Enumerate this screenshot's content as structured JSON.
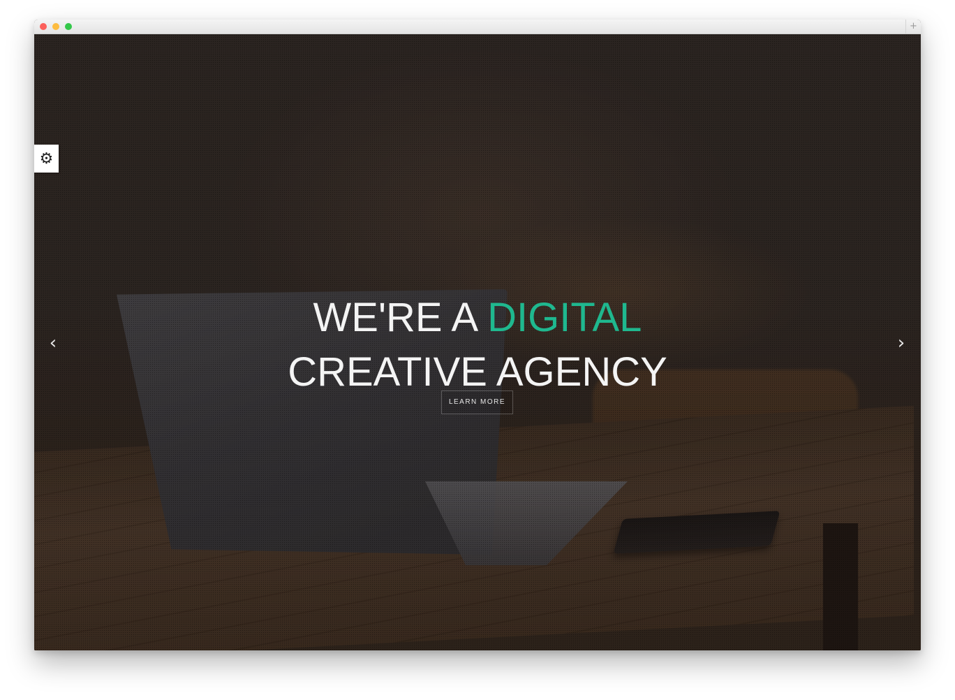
{
  "browser": {
    "traffic_lights": {
      "close_color": "#fc605b",
      "minimize_color": "#fdbc40",
      "maximize_color": "#34c84a"
    },
    "new_tab_label": "+"
  },
  "hero": {
    "headline_line1_prefix": "WE'RE A ",
    "headline_line1_accent": "DIGITAL",
    "headline_line2": "CREATIVE AGENCY",
    "cta_label": "LEARN MORE",
    "accent_color": "#1fb88f",
    "prev_arrow": "‹",
    "next_arrow": "›"
  },
  "settings": {
    "icon": "gear-icon",
    "glyph": "⚙"
  }
}
